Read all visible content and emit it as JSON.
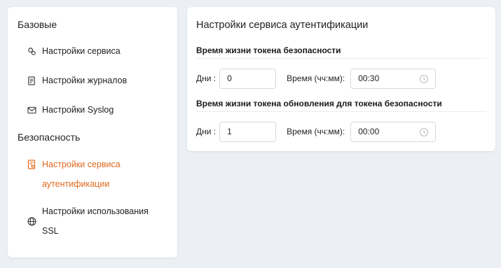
{
  "sidebar": {
    "sections": [
      {
        "title": "Базовые",
        "items": [
          {
            "label": "Настройки сервиса",
            "icon": "service-settings-icon"
          },
          {
            "label": "Настройки журналов",
            "icon": "journal-icon"
          },
          {
            "label": "Настройки Syslog",
            "icon": "mail-icon"
          }
        ]
      },
      {
        "title": "Безопасность",
        "items": [
          {
            "label_line1": "Настройки сервиса",
            "label_line2": "аутентификации",
            "icon": "auth-doc-icon",
            "active": true
          },
          {
            "label_line1": "Настройки использования",
            "label_line2": "SSL",
            "icon": "globe-icon"
          }
        ]
      }
    ]
  },
  "main": {
    "title": "Настройки сервиса аутентификации",
    "groups": [
      {
        "title": "Время жизни токена безопасности",
        "days_label": "Дни :",
        "days_value": "0",
        "time_label": "Время (чч:мм):",
        "time_value": "00:30"
      },
      {
        "title": "Время жизни токена обновления для токена безопасности",
        "days_label": "Дни :",
        "days_value": "1",
        "time_label": "Время (чч:мм):",
        "time_value": "00:00"
      }
    ]
  },
  "colors": {
    "accent": "#e06a1f",
    "background": "#eceff3",
    "card": "#ffffff",
    "border": "#d6d9de"
  }
}
